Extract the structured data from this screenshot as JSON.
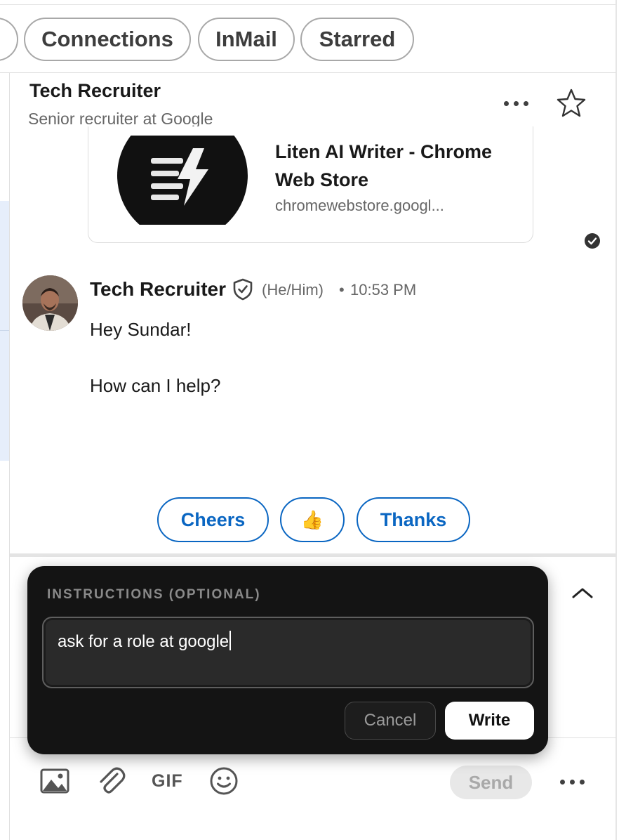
{
  "filters": {
    "items": [
      {
        "label": "Connections"
      },
      {
        "label": "InMail"
      },
      {
        "label": "Starred"
      }
    ]
  },
  "header": {
    "name": "Tech Recruiter",
    "subtitle": "Senior recruiter at Google"
  },
  "link_preview": {
    "title": "Liten AI Writer - Chrome Web Store",
    "domain": "chromewebstore.googl..."
  },
  "message": {
    "sender": "Tech Recruiter",
    "pronouns": "(He/Him)",
    "separator": "•",
    "time": "10:53 PM",
    "lines": [
      "Hey Sundar!",
      "How can I help?"
    ]
  },
  "quick_replies": [
    {
      "label": "Cheers"
    },
    {
      "label": "👍"
    },
    {
      "label": "Thanks"
    }
  ],
  "popover": {
    "label": "INSTRUCTIONS (OPTIONAL)",
    "input_value": "ask for a role at google",
    "cancel_label": "Cancel",
    "write_label": "Write"
  },
  "toolbar": {
    "gif_label": "GIF",
    "send_label": "Send"
  },
  "colors": {
    "accent": "#0a66c2",
    "popover_bg": "#141414"
  }
}
